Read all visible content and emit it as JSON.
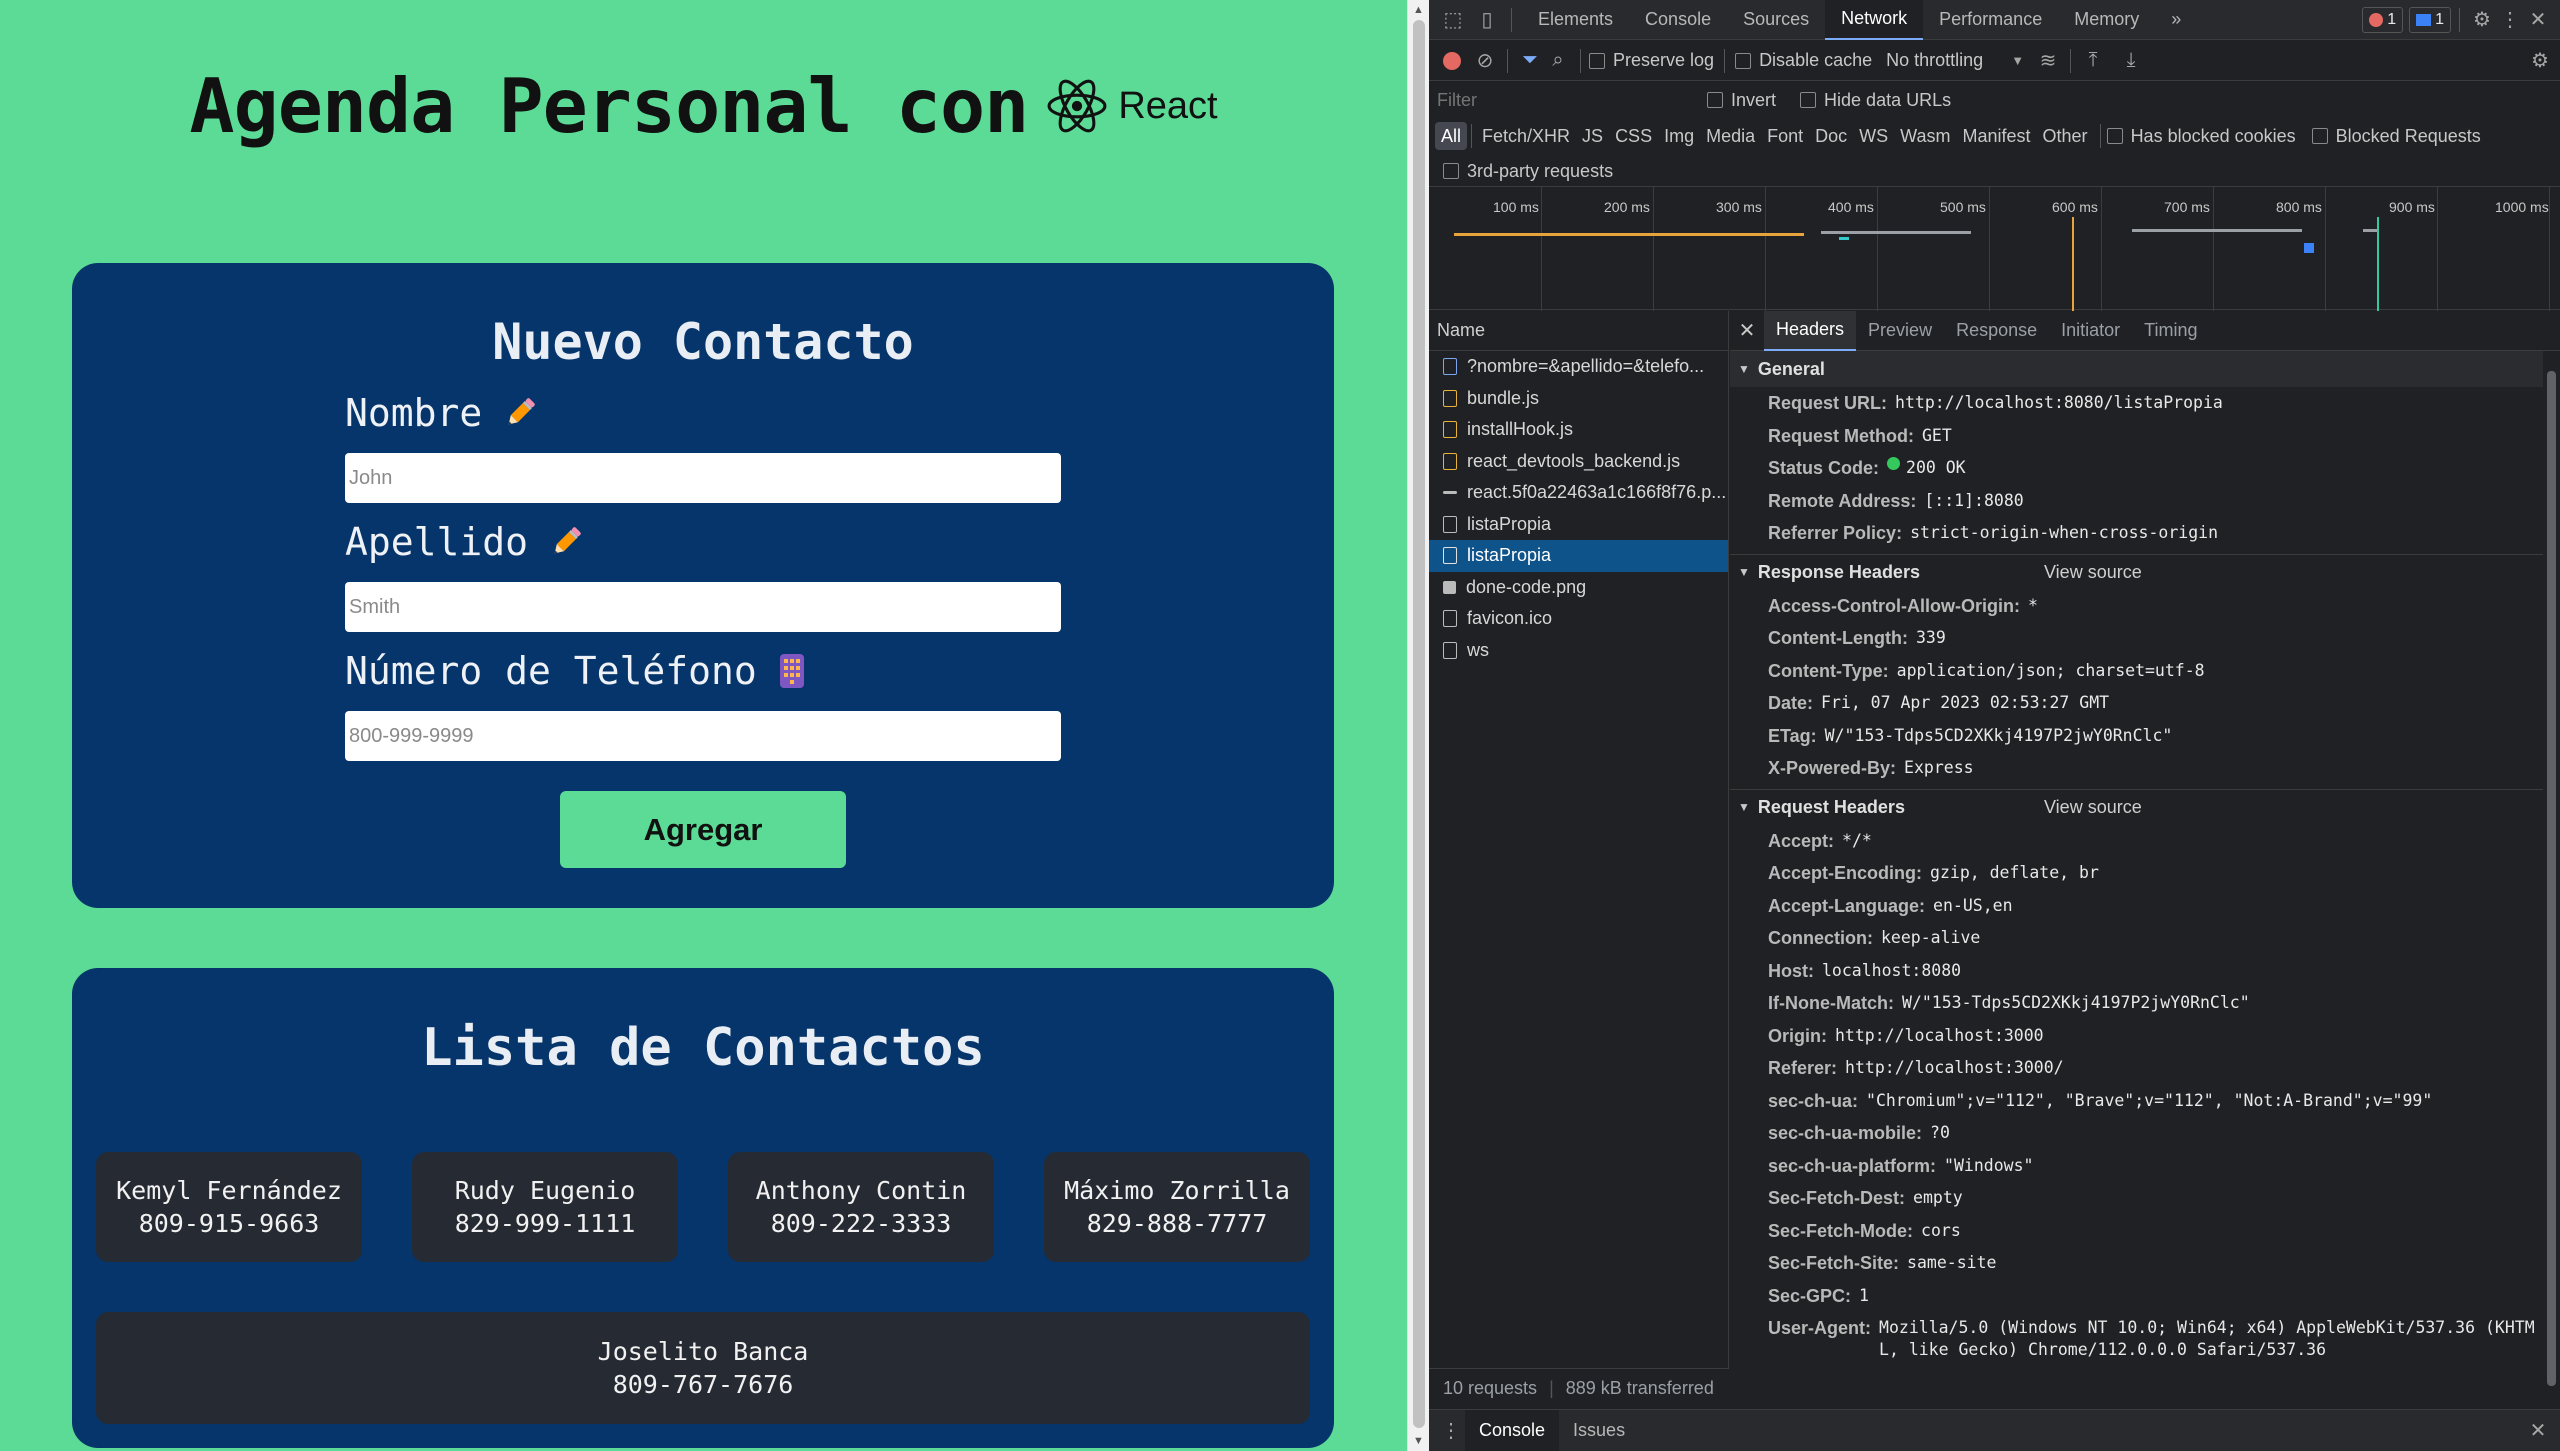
{
  "app": {
    "title": "Agenda Personal con",
    "logo_text": "React",
    "form": {
      "title": "Nuevo Contacto",
      "fields": [
        {
          "label": "Nombre",
          "placeholder": "John",
          "value": "",
          "icon": "pencil-icon"
        },
        {
          "label": "Apellido",
          "placeholder": "Smith",
          "value": "",
          "icon": "pencil-icon"
        },
        {
          "label": "Número de Teléfono",
          "placeholder": "800-999-9999",
          "value": "",
          "icon": "phone-icon"
        }
      ],
      "submit_label": "Agregar"
    },
    "list": {
      "title": "Lista de Contactos",
      "contacts": [
        {
          "name": "Kemyl Fernández",
          "phone": "809-915-9663"
        },
        {
          "name": "Rudy Eugenio",
          "phone": "829-999-1111"
        },
        {
          "name": "Anthony Contin",
          "phone": "809-222-3333"
        },
        {
          "name": "Máximo Zorrilla",
          "phone": "829-888-7777"
        },
        {
          "name": "Joselito Banca",
          "phone": "809-767-7676"
        }
      ]
    },
    "colors": {
      "background": "#5bdb95",
      "card": "#06356b",
      "contact_card": "#262a33"
    }
  },
  "devtools": {
    "tabs": [
      "Elements",
      "Console",
      "Sources",
      "Network",
      "Performance",
      "Memory"
    ],
    "active_tab": "Network",
    "more_tabs": "»",
    "error_count": "1",
    "message_count": "1",
    "toolbar": {
      "preserve_log": "Preserve log",
      "disable_cache": "Disable cache",
      "throttling": "No throttling"
    },
    "filter": {
      "placeholder": "Filter",
      "invert": "Invert",
      "hide_data_urls": "Hide data URLs",
      "types": [
        "All",
        "Fetch/XHR",
        "JS",
        "CSS",
        "Img",
        "Media",
        "Font",
        "Doc",
        "WS",
        "Wasm",
        "Manifest",
        "Other"
      ],
      "has_blocked_cookies": "Has blocked cookies",
      "blocked_requests": "Blocked Requests",
      "third_party": "3rd-party requests"
    },
    "timeline_ticks": [
      "100 ms",
      "200 ms",
      "300 ms",
      "400 ms",
      "500 ms",
      "600 ms",
      "700 ms",
      "800 ms",
      "900 ms",
      "1000 ms"
    ],
    "requests": {
      "header": "Name",
      "items": [
        {
          "name": "?nombre=&apellido=&telefo...",
          "type": "doc"
        },
        {
          "name": "bundle.js",
          "type": "js"
        },
        {
          "name": "installHook.js",
          "type": "js"
        },
        {
          "name": "react_devtools_backend.js",
          "type": "js"
        },
        {
          "name": "react.5f0a22463a1c166f8f76.p...",
          "type": "dash"
        },
        {
          "name": "listaPropia",
          "type": "other"
        },
        {
          "name": "listaPropia",
          "type": "other"
        },
        {
          "name": "done-code.png",
          "type": "img"
        },
        {
          "name": "favicon.ico",
          "type": "other"
        },
        {
          "name": "ws",
          "type": "other"
        }
      ],
      "selected_index": 6,
      "summary_requests": "10 requests",
      "summary_transferred": "889 kB transferred"
    },
    "detail_tabs": [
      "Headers",
      "Preview",
      "Response",
      "Initiator",
      "Timing"
    ],
    "general": {
      "title": "General",
      "rows": [
        {
          "k": "Request URL:",
          "v": "http://localhost:8080/listaPropia"
        },
        {
          "k": "Request Method:",
          "v": "GET"
        },
        {
          "k": "Status Code:",
          "v": "200 OK"
        },
        {
          "k": "Remote Address:",
          "v": "[::1]:8080"
        },
        {
          "k": "Referrer Policy:",
          "v": "strict-origin-when-cross-origin"
        }
      ]
    },
    "response_headers": {
      "title": "Response Headers",
      "view_source": "View source",
      "rows": [
        {
          "k": "Access-Control-Allow-Origin:",
          "v": "*"
        },
        {
          "k": "Content-Length:",
          "v": "339"
        },
        {
          "k": "Content-Type:",
          "v": "application/json; charset=utf-8"
        },
        {
          "k": "Date:",
          "v": "Fri, 07 Apr 2023 02:53:27 GMT"
        },
        {
          "k": "ETag:",
          "v": "W/\"153-Tdps5CD2XKkj4197P2jwY0RnClc\""
        },
        {
          "k": "X-Powered-By:",
          "v": "Express"
        }
      ]
    },
    "request_headers": {
      "title": "Request Headers",
      "view_source": "View source",
      "rows": [
        {
          "k": "Accept:",
          "v": "*/*"
        },
        {
          "k": "Accept-Encoding:",
          "v": "gzip, deflate, br"
        },
        {
          "k": "Accept-Language:",
          "v": "en-US,en"
        },
        {
          "k": "Connection:",
          "v": "keep-alive"
        },
        {
          "k": "Host:",
          "v": "localhost:8080"
        },
        {
          "k": "If-None-Match:",
          "v": "W/\"153-Tdps5CD2XKkj4197P2jwY0RnClc\""
        },
        {
          "k": "Origin:",
          "v": "http://localhost:3000"
        },
        {
          "k": "Referer:",
          "v": "http://localhost:3000/"
        },
        {
          "k": "sec-ch-ua:",
          "v": "\"Chromium\";v=\"112\", \"Brave\";v=\"112\", \"Not:A-Brand\";v=\"99\""
        },
        {
          "k": "sec-ch-ua-mobile:",
          "v": "?0"
        },
        {
          "k": "sec-ch-ua-platform:",
          "v": "\"Windows\""
        },
        {
          "k": "Sec-Fetch-Dest:",
          "v": "empty"
        },
        {
          "k": "Sec-Fetch-Mode:",
          "v": "cors"
        },
        {
          "k": "Sec-Fetch-Site:",
          "v": "same-site"
        },
        {
          "k": "Sec-GPC:",
          "v": "1"
        },
        {
          "k": "User-Agent:",
          "v": "Mozilla/5.0 (Windows NT 10.0; Win64; x64) AppleWebKit/537.36 (KHTML, like Gecko) Chrome/112.0.0.0 Safari/537.36"
        }
      ]
    },
    "drawer_tabs": [
      "Console",
      "Issues"
    ]
  }
}
